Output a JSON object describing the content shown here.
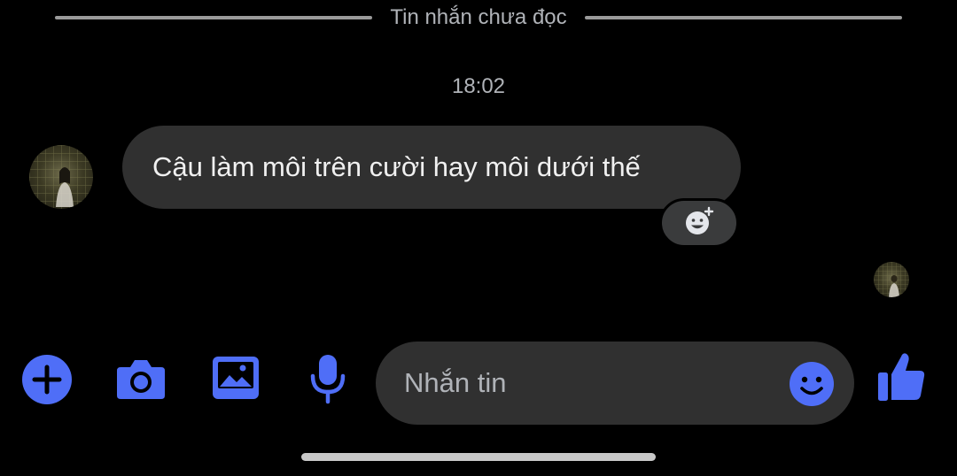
{
  "conversation": {
    "unread_divider": "Tin nhắn chưa đọc",
    "timestamp": "18:02",
    "messages": [
      {
        "direction": "incoming",
        "text": "Cậu làm môi trên cười hay môi dưới thế"
      }
    ]
  },
  "composer": {
    "placeholder": "Nhắn tin"
  },
  "icons": {
    "plus": "plus-circle-icon",
    "camera": "camera-icon",
    "gallery": "image-icon",
    "mic": "microphone-icon",
    "emoji": "smiley-icon",
    "like": "thumbs-up-icon",
    "react": "add-reaction-icon"
  },
  "colors": {
    "background": "#000000",
    "bubble": "#303030",
    "accent": "#4f6ef7",
    "secondary_text": "#b0b3b8"
  }
}
